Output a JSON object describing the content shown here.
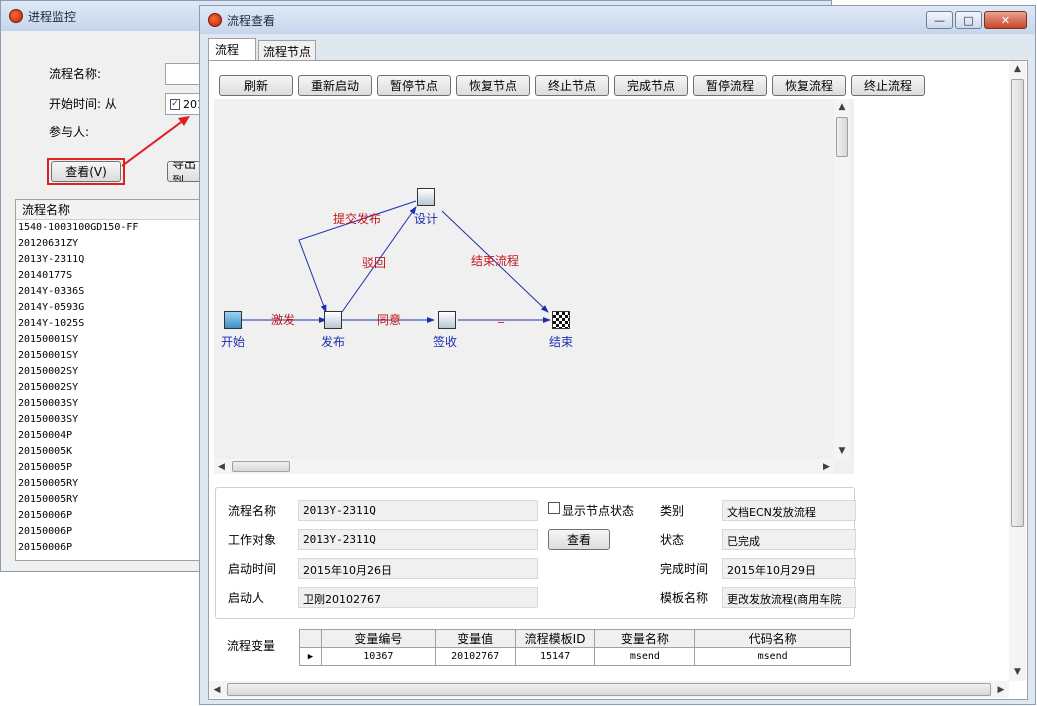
{
  "bg_window": {
    "title": "进程监控",
    "labels": {
      "flow_name": "流程名称:",
      "start_time": "开始时间: 从",
      "participant": "参与人:"
    },
    "checkbox_partial": "201",
    "view_button": "查看(V)",
    "export_button": "导出到",
    "list_header": "流程名称",
    "list_items": [
      "1540-1003100GD150-FF",
      "20120631ZY",
      "2013Y-2311Q",
      "20140177S",
      "2014Y-0336S",
      "2014Y-0593G",
      "2014Y-1025S",
      "20150001SY",
      "20150001SY",
      "20150002SY",
      "20150002SY",
      "20150003SY",
      "20150003SY",
      "20150004P",
      "20150005K",
      "20150005P",
      "20150005RY",
      "20150005RY",
      "20150006P",
      "20150006P",
      "20150006P"
    ]
  },
  "main_window": {
    "title": "流程查看",
    "controls": {
      "minimize": "—",
      "maximize": "□",
      "close": "✕"
    },
    "tabs": [
      {
        "label": "流程"
      },
      {
        "label": "流程节点"
      }
    ],
    "toolbar": [
      "刷新",
      "重新启动",
      "暂停节点",
      "恢复节点",
      "终止节点",
      "完成节点",
      "暂停流程",
      "恢复流程",
      "终止流程"
    ],
    "diagram": {
      "nodes": {
        "start": "开始",
        "publish": "发布",
        "design": "设计",
        "sign": "签收",
        "end": "结束"
      },
      "edges": {
        "activate": "激发",
        "submit": "提交发布",
        "reject": "驳回",
        "agree": "同意",
        "finish": "结束流程",
        "dash": "_"
      }
    },
    "info": {
      "labels": {
        "flow_name": "流程名称",
        "work_object": "工作对象",
        "start_time": "启动时间",
        "starter": "启动人",
        "category": "类别",
        "status": "状态",
        "finish_time": "完成时间",
        "template_name": "模板名称"
      },
      "values": {
        "flow_name": "2013Y-2311Q",
        "work_object": "2013Y-2311Q",
        "start_time": "2015年10月26日",
        "starter": "卫刚20102767",
        "category": "文档ECN发放流程",
        "status": "已完成",
        "finish_time": "2015年10月29日",
        "template_name": "更改发放流程(商用车院"
      },
      "show_node_status": "显示节点状态",
      "view_button": "查看"
    },
    "variables": {
      "label": "流程变量",
      "columns": [
        "变量编号",
        "变量值",
        "流程模板ID",
        "变量名称",
        "代码名称"
      ],
      "rows": [
        [
          "10367",
          "20102767",
          "15147",
          "msend",
          "msend"
        ]
      ]
    }
  },
  "colors": {
    "accent_red": "#e02020",
    "edge_blue": "#1c2fb0",
    "edge_label_red": "#c4161c"
  }
}
